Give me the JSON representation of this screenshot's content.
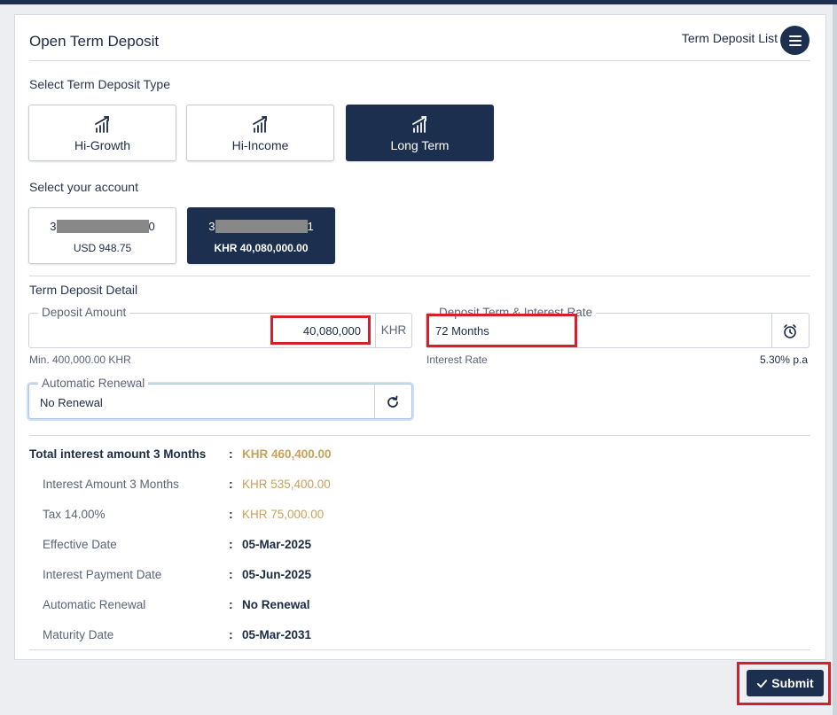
{
  "header": {
    "title": "Open Term Deposit",
    "list_link": "Term Deposit List"
  },
  "deposit_type": {
    "label": "Select Term Deposit Type",
    "options": [
      {
        "label": "Hi-Growth",
        "icon": "growth-chart-icon",
        "selected": false
      },
      {
        "label": "Hi-Income",
        "icon": "growth-chart-icon",
        "selected": false
      },
      {
        "label": "Long Term",
        "icon": "growth-chart-icon",
        "selected": true
      }
    ]
  },
  "account": {
    "label": "Select your account",
    "options": [
      {
        "number_prefix": "3",
        "number_suffix": "0",
        "balance": "USD 948.75",
        "selected": false
      },
      {
        "number_prefix": "3",
        "number_suffix": "1",
        "balance": "KHR 40,080,000.00",
        "selected": true
      }
    ]
  },
  "detail": {
    "label": "Term Deposit Detail",
    "deposit_amount": {
      "legend": "Deposit Amount",
      "value": "40,080,000",
      "currency": "KHR",
      "min_note": "Min. 400,000.00 KHR"
    },
    "term": {
      "legend": "Deposit Term & Interest Rate",
      "value": "72 Months",
      "rate_label": "Interest Rate",
      "rate_value": "5.30% p.a",
      "icon": "alarm-clock-icon"
    },
    "renewal": {
      "legend": "Automatic Renewal",
      "value": "No Renewal",
      "icon": "refresh-icon"
    }
  },
  "summary": {
    "rows": [
      {
        "label": "Total interest amount 3 Months",
        "value": "KHR 460,400.00"
      },
      {
        "label": "Interest Amount 3 Months",
        "value": "KHR 535,400.00"
      },
      {
        "label": "Tax 14.00%",
        "value": "KHR 75,000.00"
      },
      {
        "label": "Effective Date",
        "value": "05-Mar-2025"
      },
      {
        "label": "Interest Payment Date",
        "value": "05-Jun-2025"
      },
      {
        "label": "Automatic Renewal",
        "value": "No Renewal"
      },
      {
        "label": "Maturity Date",
        "value": "05-Mar-2031"
      }
    ]
  },
  "actions": {
    "submit_label": "Submit",
    "submit_icon": "check-icon"
  },
  "colors": {
    "primary": "#1c2f4f",
    "gold": "#c8a15a",
    "highlight": "#d61f2c"
  }
}
